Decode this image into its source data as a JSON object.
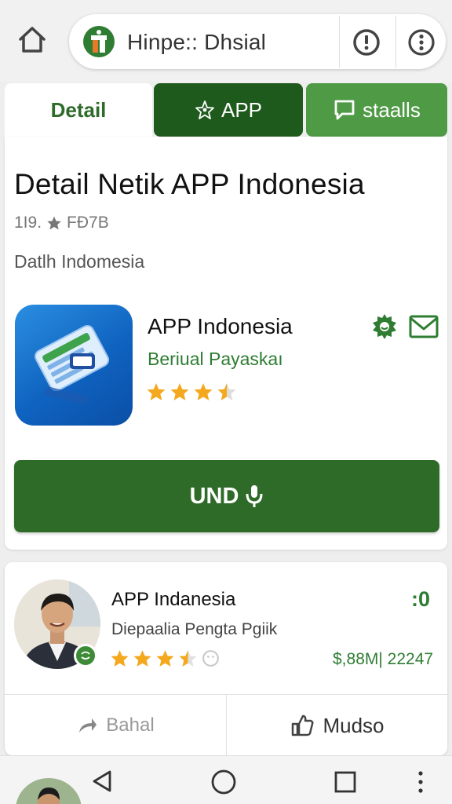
{
  "browser": {
    "url_text": "Hinpe:: Dhsial",
    "home_icon": "home-icon",
    "info_icon": "info-icon",
    "more_icon": "more-vert-icon"
  },
  "tabs": [
    {
      "label": "Detail",
      "icon": null,
      "active": true
    },
    {
      "label": "APP",
      "icon": "star-outline-icon",
      "active": false
    },
    {
      "label": "staalls",
      "icon": "chat-icon",
      "active": false
    }
  ],
  "page": {
    "title": "Detail Netik APP Indonesia",
    "meta_count": "1Ι9.",
    "meta_code": "FÐ7B",
    "subtitle": "Datlh Indomesia"
  },
  "app": {
    "name": "APP Indonesia",
    "developer": "Beriual Payaskaı",
    "rating": 3.5,
    "action_label": "UND"
  },
  "review": {
    "name": "APP Indanesia",
    "score": ":0",
    "description": "Diepaalia Pengta Pgiik",
    "rating": 3.5,
    "price": "$,88M| 22247",
    "share_label": "Bahal",
    "like_label": "Mudso"
  },
  "colors": {
    "primary_green": "#2f6b28",
    "dark_green": "#1e5a1c",
    "light_green": "#4f9a45",
    "star": "#f4a81d",
    "app_blue": "#1a74d0"
  }
}
